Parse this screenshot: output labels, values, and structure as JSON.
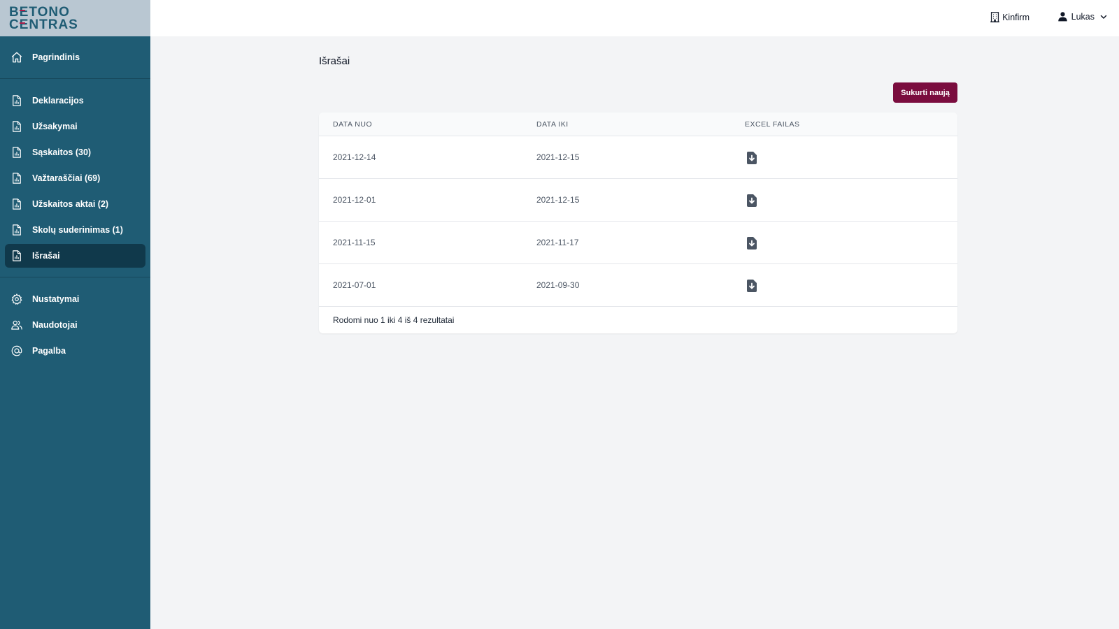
{
  "brand": {
    "logo_line1": "BETONO",
    "logo_line2": "CENTRAS",
    "logo_color": "#1f5c74",
    "accent_color": "#b01e4a"
  },
  "header": {
    "company": "Kinfirm",
    "company_icon": "building-icon",
    "user": "Lukas",
    "user_icon": "person-icon"
  },
  "sidebar": {
    "primary": [
      {
        "label": "Pagrindinis",
        "icon": "home-icon"
      }
    ],
    "documents": [
      {
        "label": "Deklaracijos",
        "icon": "document-chart-icon"
      },
      {
        "label": "Užsakymai",
        "icon": "document-chart-icon"
      },
      {
        "label": "Sąskaitos (30)",
        "icon": "document-chart-icon"
      },
      {
        "label": "Važtaraščiai (69)",
        "icon": "document-chart-icon"
      },
      {
        "label": "Užskaitos aktai (2)",
        "icon": "document-chart-icon"
      },
      {
        "label": "Skolų suderinimas (1)",
        "icon": "document-chart-icon"
      },
      {
        "label": "Išrašai",
        "icon": "document-chart-icon",
        "active": true
      }
    ],
    "settings": [
      {
        "label": "Nustatymai",
        "icon": "gear-icon"
      },
      {
        "label": "Naudotojai",
        "icon": "users-icon"
      },
      {
        "label": "Pagalba",
        "icon": "at-sign-icon"
      }
    ]
  },
  "main": {
    "title": "Išrašai",
    "create_button": "Sukurti naują",
    "create_button_color": "#7a0c3e",
    "table": {
      "headers": [
        "DATA NUO",
        "DATA IKI",
        "EXCEL FAILAS"
      ],
      "rows": [
        {
          "from": "2021-12-14",
          "to": "2021-12-15",
          "file_icon": "document-download-icon"
        },
        {
          "from": "2021-12-01",
          "to": "2021-12-15",
          "file_icon": "document-download-icon"
        },
        {
          "from": "2021-11-15",
          "to": "2021-11-17",
          "file_icon": "document-download-icon"
        },
        {
          "from": "2021-07-01",
          "to": "2021-09-30",
          "file_icon": "document-download-icon"
        }
      ],
      "footer": "Rodomi nuo 1 iki 4 iš 4 rezultatai"
    }
  }
}
